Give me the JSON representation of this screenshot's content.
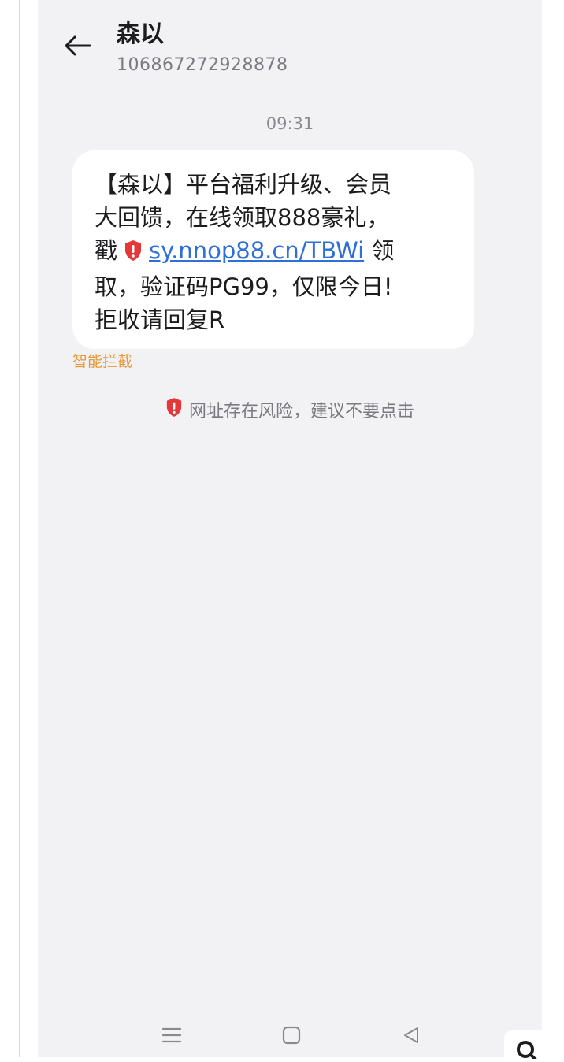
{
  "header": {
    "contact_name": "森以",
    "contact_number": "106867272928878"
  },
  "conversation": {
    "timestamp": "09:31",
    "message": {
      "line1": "【森以】平台福利升级、会员",
      "line2": "大回馈，在线领取888豪礼，",
      "line3_prefix": "戳",
      "link_text": "sy.nnop88.cn/TBWi",
      "line3_suffix": "领",
      "line4": "取，验证码PG99，仅限今日!",
      "line5": "拒收请回复R"
    },
    "intercept_label": "智能拦截",
    "risk_warning": "网址存在风险，建议不要点击"
  },
  "colors": {
    "screen_bg": "#f2f2f4",
    "bubble_bg": "#ffffff",
    "link": "#2f6fd8",
    "warning_shield": "#e5363a",
    "intercept": "#e8973a"
  },
  "icons": {
    "back": "back-arrow-icon",
    "shield": "warning-shield-icon",
    "nav_menu": "menu-icon",
    "nav_home": "home-square-icon",
    "nav_back": "back-triangle-icon",
    "corner": "search-icon"
  }
}
